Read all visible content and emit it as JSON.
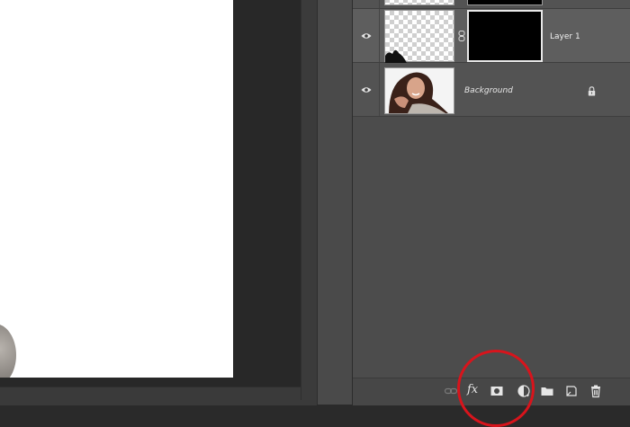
{
  "layers": [
    {
      "name": "Layer 1",
      "name_italic": false,
      "visible": true,
      "selected": true,
      "has_mask": true
    },
    {
      "name": "Background",
      "name_italic": true,
      "visible": true,
      "selected": false,
      "locked": true
    }
  ],
  "footer_icons": [
    "link-icon",
    "fx-icon",
    "mask-icon",
    "adjustment-icon",
    "folder-icon",
    "new-layer-icon",
    "trash-icon"
  ],
  "fx_label": "fx",
  "colors": {
    "panel_bg": "#4c4c4c",
    "selected_row": "#5a5a5a",
    "highlight_ring": "#d8141c",
    "document_bg": "#ffffff"
  }
}
